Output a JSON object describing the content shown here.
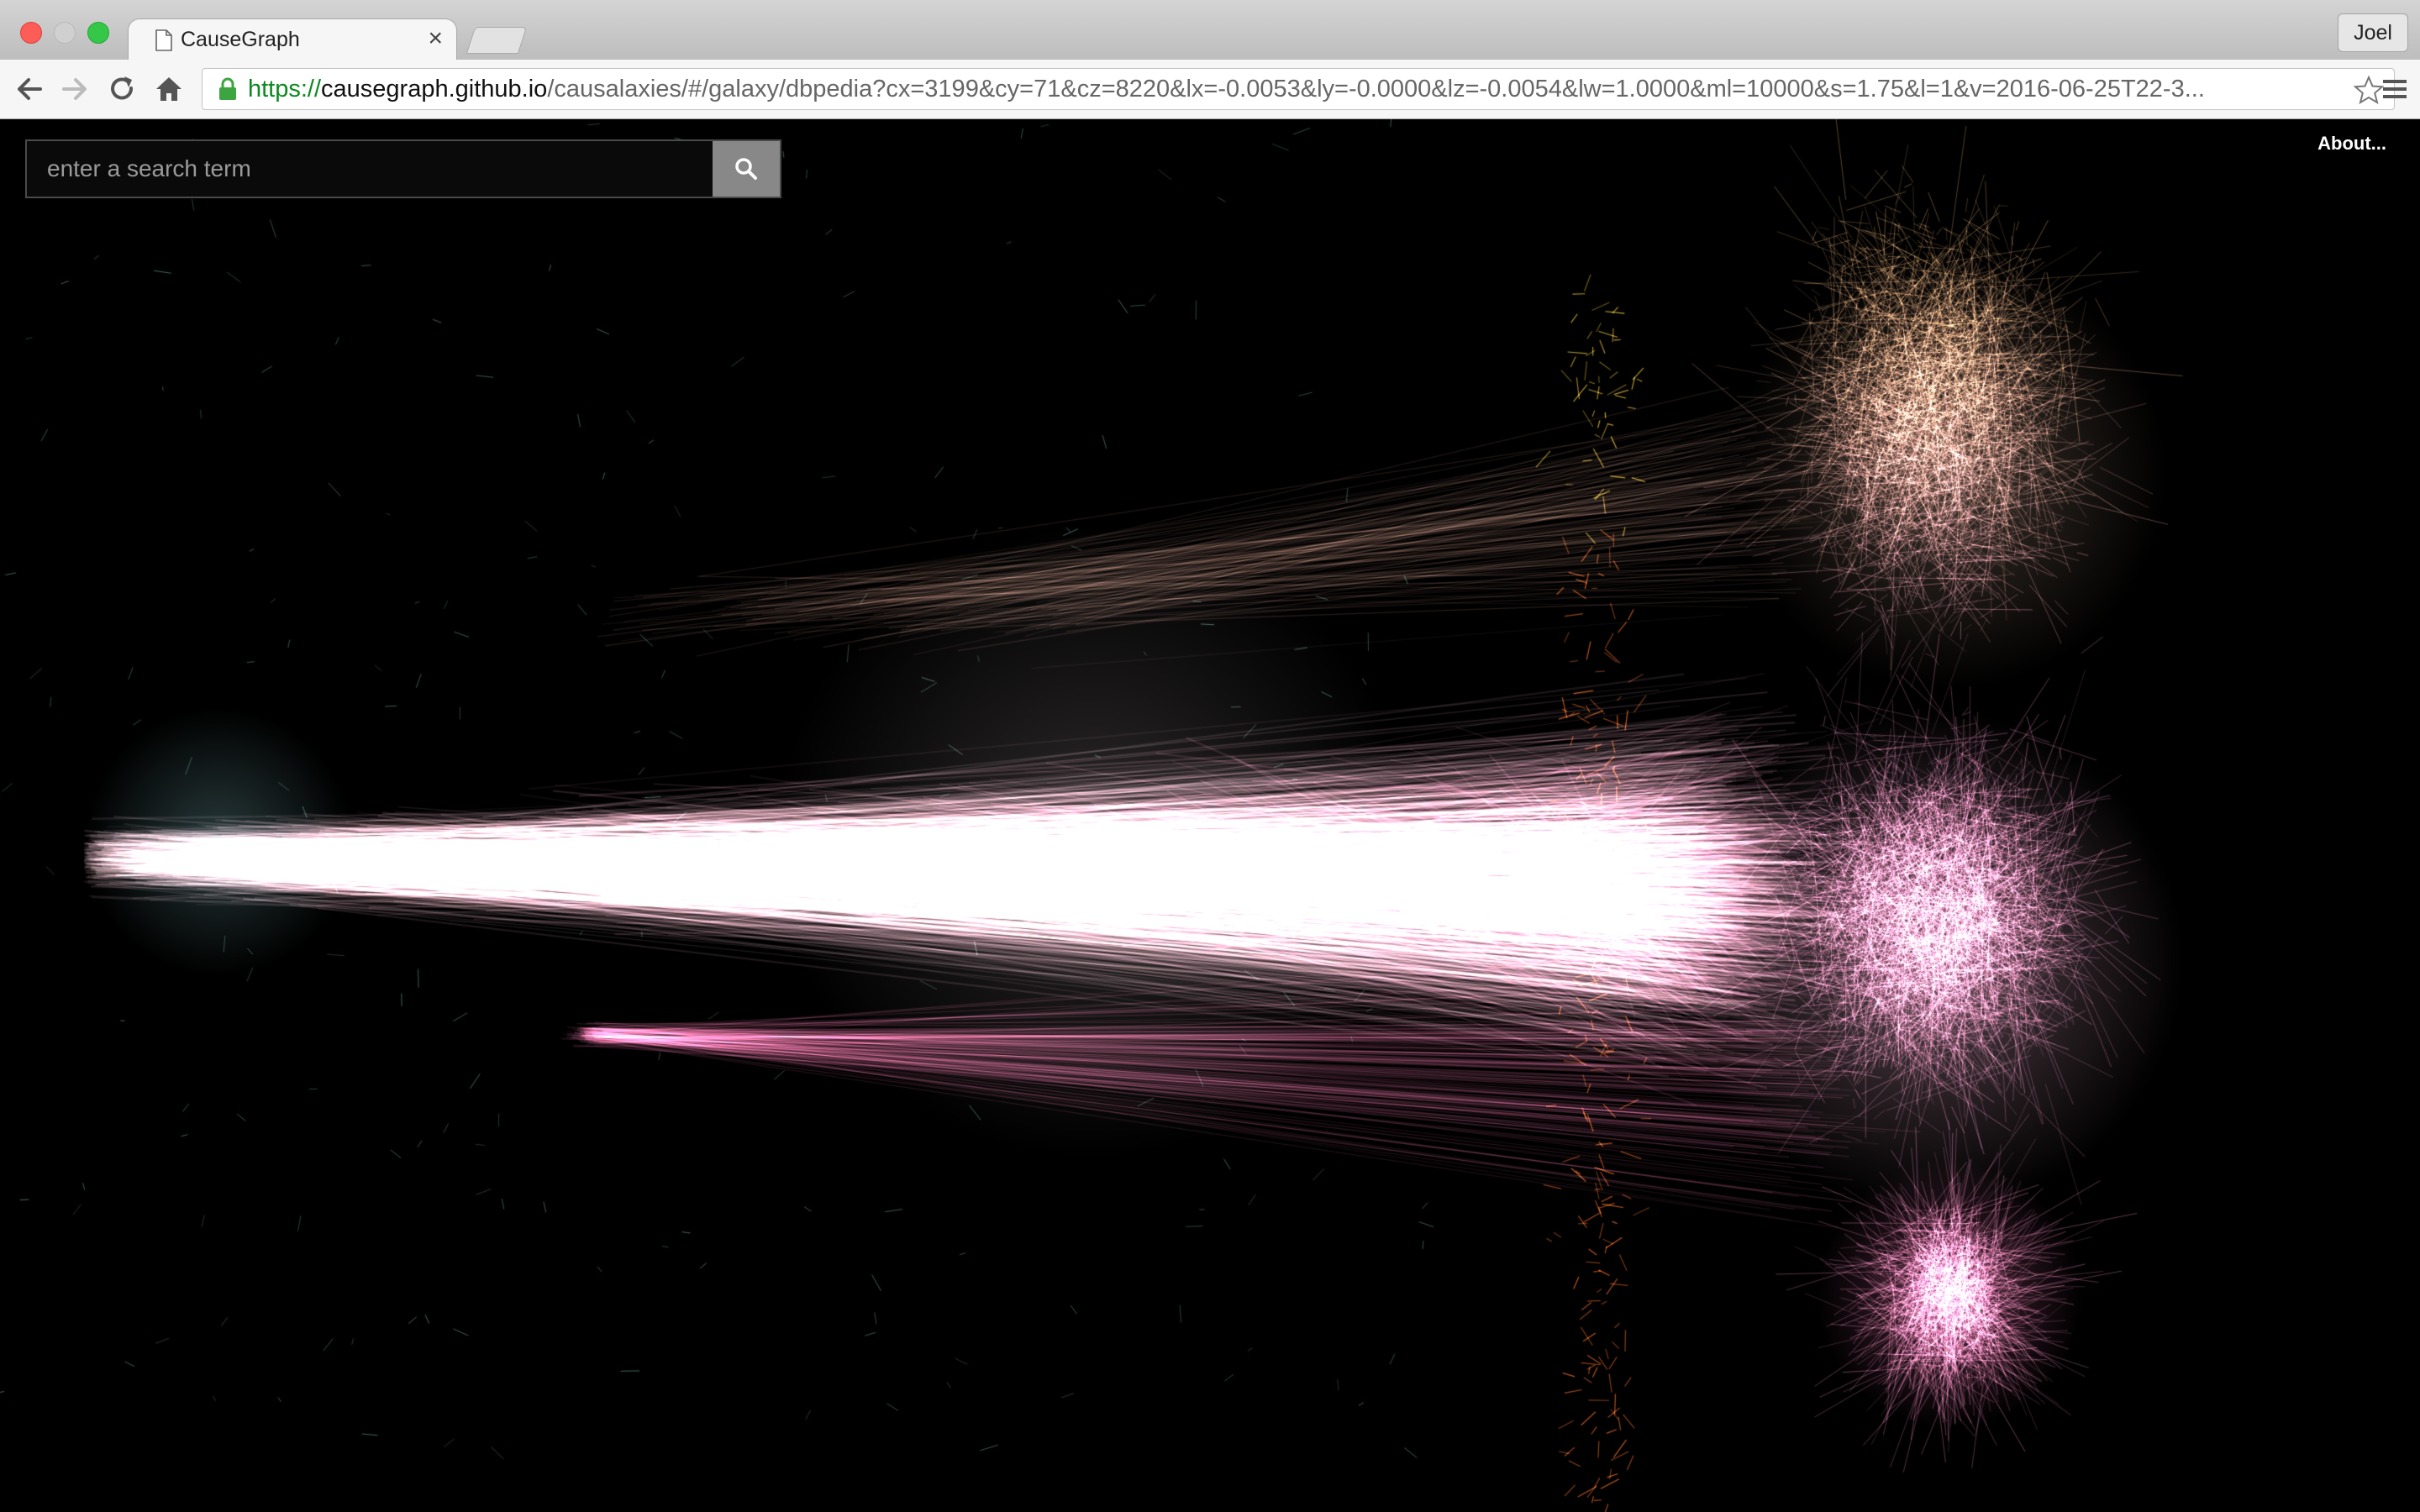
{
  "browser": {
    "tab_title": "CauseGraph",
    "tab_close": "×",
    "profile_name": "Joel",
    "url_scheme": "https://",
    "url_host": "causegraph.github.io",
    "url_rest": "/causalaxies/#/galaxy/dbpedia?cx=3199&cy=71&cz=8220&lx=-0.0053&ly=-0.0000&lz=-0.0054&lw=1.0000&ml=10000&s=1.75&l=1&v=2016-06-25T22-3...",
    "icons": [
      "back-icon",
      "forward-icon",
      "reload-icon",
      "home-icon",
      "lock-icon",
      "star-icon",
      "menu-icon",
      "page-icon"
    ]
  },
  "page": {
    "search_placeholder": "enter a search term",
    "search_icon": "search-icon",
    "about_label": "About..."
  },
  "colors": {
    "background": "#000000",
    "teal": "#8fdde0",
    "white": "#ffffff",
    "pink": "#ff6fb5",
    "peach": "#f2b48a",
    "orange": "#e0802a"
  }
}
